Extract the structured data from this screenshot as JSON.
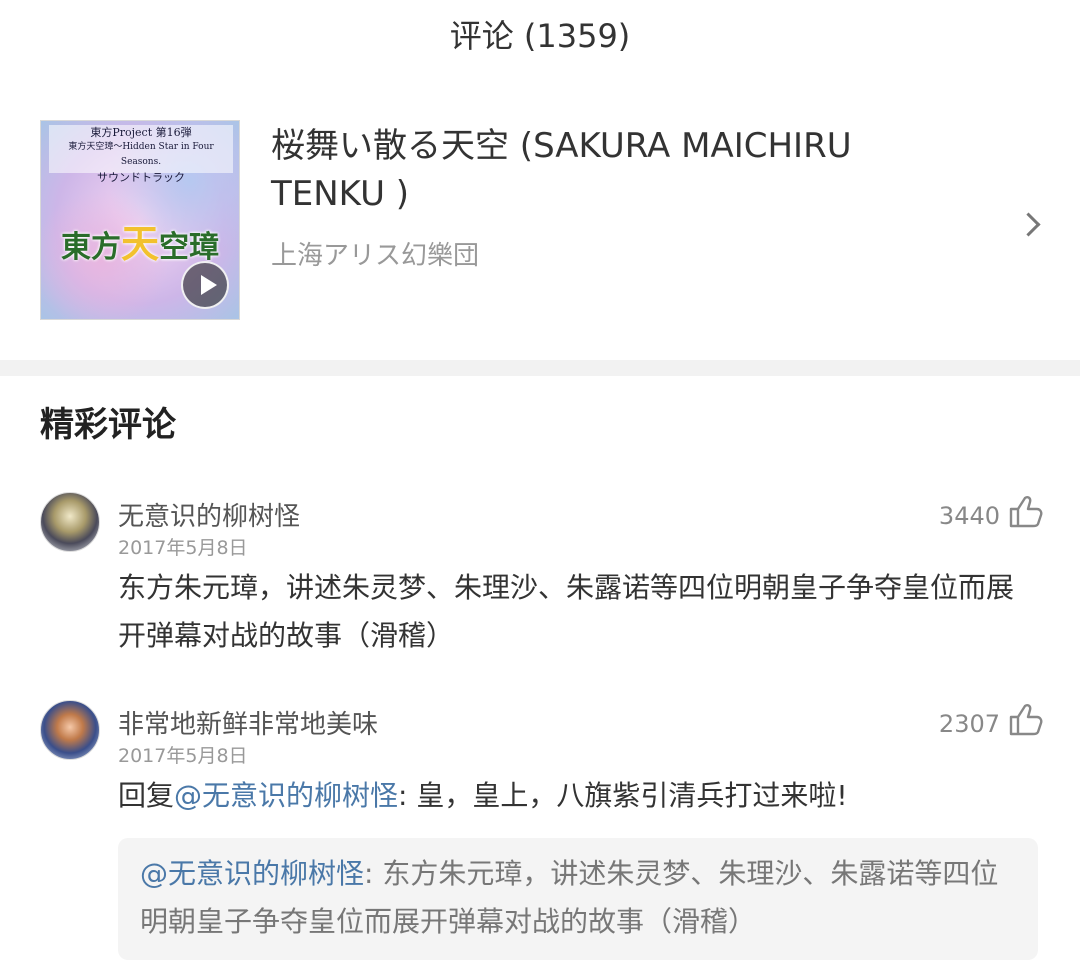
{
  "header": {
    "title": "评论 (1359)"
  },
  "song": {
    "title": "桜舞い散る天空 (SAKURA MAICHIRU TENKU )",
    "artist": "上海アリス幻樂団",
    "cover": {
      "line1": "東方Project 第16弾",
      "line2": "東方天空璋～Hidden Star in Four Seasons.",
      "line3": "サウンドトラック",
      "logo_a": "東方",
      "logo_b": "天",
      "logo_c": "空璋"
    }
  },
  "section": {
    "title": "精彩评论"
  },
  "comments": [
    {
      "username": "无意识的柳树怪",
      "date": "2017年5月8日",
      "likes": "3440",
      "content": "东方朱元璋，讲述朱灵梦、朱理沙、朱露诺等四位明朝皇子争夺皇位而展开弹幕对战的故事（滑稽）"
    },
    {
      "username": "非常地新鲜非常地美味",
      "date": "2017年5月8日",
      "likes": "2307",
      "reply_prefix": "回复",
      "reply_mention": "@无意识的柳树怪",
      "content": ": 皇，皇上，八旗紫引清兵打过来啦!",
      "quote": {
        "mention": "@无意识的柳树怪",
        "text": ": 东方朱元璋，讲述朱灵梦、朱理沙、朱露诺等四位明朝皇子争夺皇位而展开弹幕对战的故事（滑稽）"
      }
    }
  ],
  "icons": {
    "like": "thumbs-up-icon",
    "chevron": "chevron-right-icon",
    "play": "play-icon"
  }
}
